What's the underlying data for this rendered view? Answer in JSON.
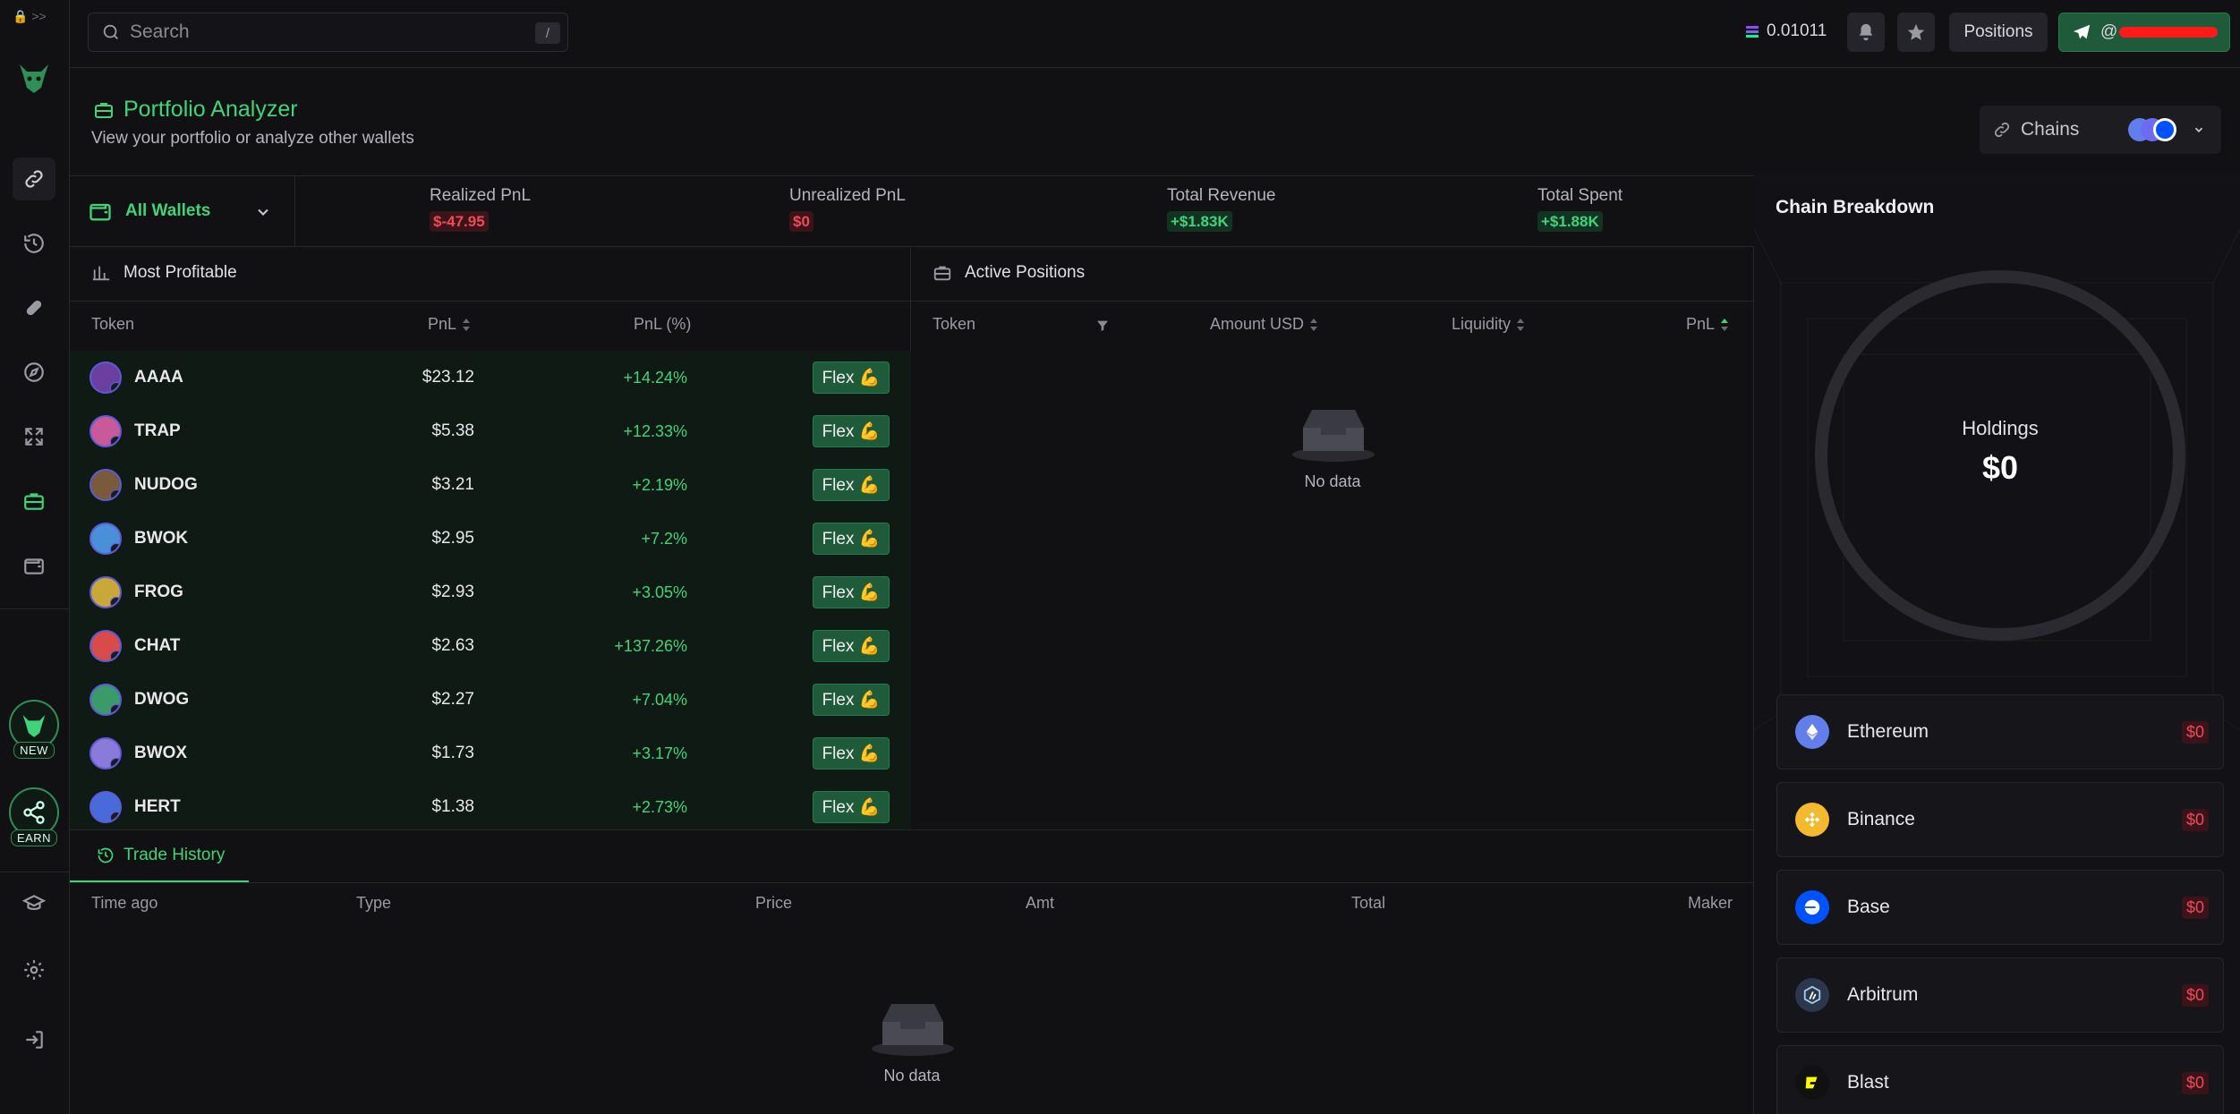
{
  "topbar": {
    "search_placeholder": "Search",
    "search_shortcut": "/",
    "balance": "0.01011",
    "positions_label": "Positions",
    "telegram_handle": "@"
  },
  "header": {
    "title": "Portfolio Analyzer",
    "subtitle": "View your portfolio or analyze other wallets",
    "chains_label": "Chains"
  },
  "stats": {
    "wallet_select": "All Wallets",
    "items": [
      {
        "label": "Realized PnL",
        "value": "$-47.95"
      },
      {
        "label": "Unrealized PnL",
        "value": "$0"
      },
      {
        "label": "Total Revenue",
        "value": "+$1.83K"
      },
      {
        "label": "Total Spent",
        "value": "+$1.88K"
      }
    ]
  },
  "most_profitable": {
    "title": "Most Profitable",
    "columns": [
      "Token",
      "PnL",
      "PnL (%)"
    ],
    "flex_label": "Flex 💪",
    "rows": [
      {
        "token": "AAAA",
        "pnl": "$23.12",
        "pct": "+14.24%",
        "color": "#6b3fa0"
      },
      {
        "token": "TRAP",
        "pnl": "$5.38",
        "pct": "+12.33%",
        "color": "#c85a9a"
      },
      {
        "token": "NUDOG",
        "pnl": "$3.21",
        "pct": "+2.19%",
        "color": "#7a5a3a"
      },
      {
        "token": "BWOK",
        "pnl": "$2.95",
        "pct": "+7.2%",
        "color": "#4a90d9"
      },
      {
        "token": "FROG",
        "pnl": "$2.93",
        "pct": "+3.05%",
        "color": "#c9a83a"
      },
      {
        "token": "CHAT",
        "pnl": "$2.63",
        "pct": "+137.26%",
        "color": "#d94a4a"
      },
      {
        "token": "DWOG",
        "pnl": "$2.27",
        "pct": "+7.04%",
        "color": "#3a9a6a"
      },
      {
        "token": "BWOX",
        "pnl": "$1.73",
        "pct": "+3.17%",
        "color": "#8a7ad9"
      },
      {
        "token": "HERT",
        "pnl": "$1.38",
        "pct": "+2.73%",
        "color": "#4a6ad9"
      }
    ]
  },
  "active_positions": {
    "title": "Active Positions",
    "columns": [
      "Token",
      "Amount USD",
      "Liquidity",
      "PnL"
    ],
    "empty": "No data"
  },
  "trade_history": {
    "tab": "Trade History",
    "columns": [
      "Time ago",
      "Type",
      "Price",
      "Amt",
      "Total",
      "Maker"
    ],
    "empty": "No data"
  },
  "chain_breakdown": {
    "title": "Chain Breakdown",
    "holdings_label": "Holdings",
    "holdings_value": "$0",
    "chains": [
      {
        "name": "Ethereum",
        "value": "$0",
        "icon": "ethereum-icon",
        "color": "#627eea"
      },
      {
        "name": "Binance",
        "value": "$0",
        "icon": "binance-icon",
        "color": "#f3ba2f"
      },
      {
        "name": "Base",
        "value": "$0",
        "icon": "base-icon",
        "color": "#0052ff"
      },
      {
        "name": "Arbitrum",
        "value": "$0",
        "icon": "arbitrum-icon",
        "color": "#2d374b"
      },
      {
        "name": "Blast",
        "value": "$0",
        "icon": "blast-icon",
        "color": "#fcfc03"
      }
    ]
  },
  "sidebar": {
    "new_label": "NEW",
    "earn_label": "EARN"
  }
}
